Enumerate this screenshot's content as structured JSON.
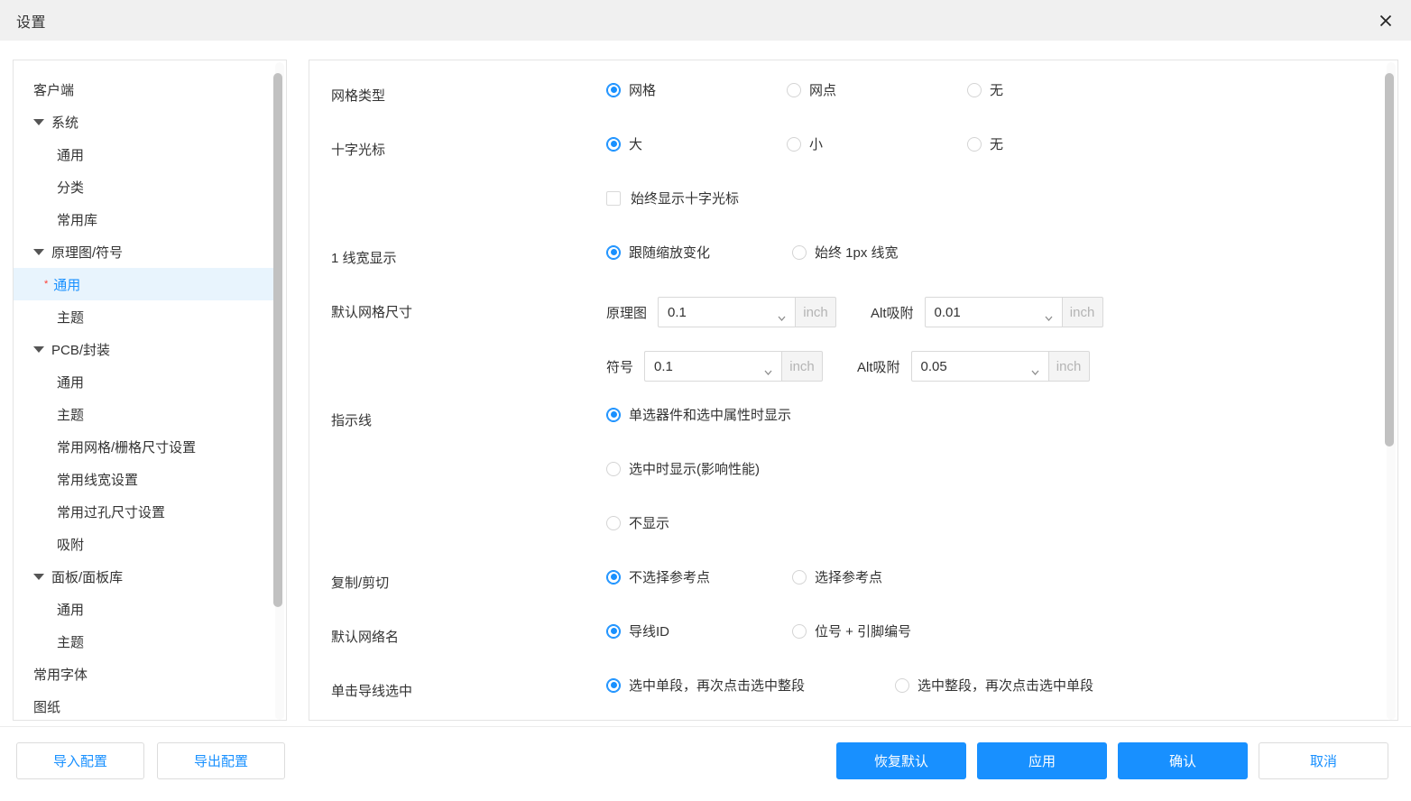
{
  "window": {
    "title": "设置",
    "close_icon": "close-icon"
  },
  "sidebar": {
    "items": [
      {
        "label": "客户端",
        "level": 0,
        "group": false,
        "selected": false,
        "required": false
      },
      {
        "label": "系统",
        "level": 0,
        "group": true,
        "selected": false,
        "required": false
      },
      {
        "label": "通用",
        "level": 1,
        "group": false,
        "selected": false,
        "required": false
      },
      {
        "label": "分类",
        "level": 1,
        "group": false,
        "selected": false,
        "required": false
      },
      {
        "label": "常用库",
        "level": 1,
        "group": false,
        "selected": false,
        "required": false
      },
      {
        "label": "原理图/符号",
        "level": 0,
        "group": true,
        "selected": false,
        "required": false
      },
      {
        "label": "通用",
        "level": 1,
        "group": false,
        "selected": true,
        "required": true
      },
      {
        "label": "主题",
        "level": 1,
        "group": false,
        "selected": false,
        "required": false
      },
      {
        "label": "PCB/封装",
        "level": 0,
        "group": true,
        "selected": false,
        "required": false
      },
      {
        "label": "通用",
        "level": 1,
        "group": false,
        "selected": false,
        "required": false
      },
      {
        "label": "主题",
        "level": 1,
        "group": false,
        "selected": false,
        "required": false
      },
      {
        "label": "常用网格/栅格尺寸设置",
        "level": 1,
        "group": false,
        "selected": false,
        "required": false
      },
      {
        "label": "常用线宽设置",
        "level": 1,
        "group": false,
        "selected": false,
        "required": false
      },
      {
        "label": "常用过孔尺寸设置",
        "level": 1,
        "group": false,
        "selected": false,
        "required": false
      },
      {
        "label": "吸附",
        "level": 1,
        "group": false,
        "selected": false,
        "required": false
      },
      {
        "label": "面板/面板库",
        "level": 0,
        "group": true,
        "selected": false,
        "required": false
      },
      {
        "label": "通用",
        "level": 1,
        "group": false,
        "selected": false,
        "required": false
      },
      {
        "label": "主题",
        "level": 1,
        "group": false,
        "selected": false,
        "required": false
      },
      {
        "label": "常用字体",
        "level": 0,
        "group": false,
        "selected": false,
        "required": false
      },
      {
        "label": "图纸",
        "level": 0,
        "group": false,
        "selected": false,
        "required": false
      }
    ]
  },
  "settings": {
    "grid_type": {
      "label": "网格类型",
      "options": [
        {
          "label": "网格",
          "selected": true
        },
        {
          "label": "网点",
          "selected": false
        },
        {
          "label": "无",
          "selected": false
        }
      ]
    },
    "crosshair": {
      "label": "十字光标",
      "options": [
        {
          "label": "大",
          "selected": true
        },
        {
          "label": "小",
          "selected": false
        },
        {
          "label": "无",
          "selected": false
        }
      ],
      "always_show": {
        "label": "始终显示十字光标",
        "checked": false
      }
    },
    "line_width_display": {
      "label": "1 线宽显示",
      "options": [
        {
          "label": "跟随缩放变化",
          "selected": true
        },
        {
          "label": "始终 1px 线宽",
          "selected": false
        }
      ]
    },
    "default_grid_size": {
      "label": "默认网格尺寸",
      "rows": [
        {
          "name_label": "原理图",
          "value": "0.1",
          "unit": "inch",
          "alt_label": "Alt吸附",
          "alt_value": "0.01",
          "alt_unit": "inch"
        },
        {
          "name_label": "符号",
          "value": "0.1",
          "unit": "inch",
          "alt_label": "Alt吸附",
          "alt_value": "0.05",
          "alt_unit": "inch"
        }
      ]
    },
    "leader_line": {
      "label": "指示线",
      "options": [
        {
          "label": "单选器件和选中属性时显示",
          "selected": true
        },
        {
          "label": "选中时显示(影响性能)",
          "selected": false
        },
        {
          "label": "不显示",
          "selected": false
        }
      ]
    },
    "copy_cut": {
      "label": "复制/剪切",
      "options": [
        {
          "label": "不选择参考点",
          "selected": true
        },
        {
          "label": "选择参考点",
          "selected": false
        }
      ]
    },
    "default_net_name": {
      "label": "默认网络名",
      "options": [
        {
          "label": "导线ID",
          "selected": true
        },
        {
          "label": "位号 + 引脚编号",
          "selected": false
        }
      ]
    },
    "click_wire_select": {
      "label": "单击导线选中",
      "options": [
        {
          "label": "选中单段，再次点击选中整段",
          "selected": true
        },
        {
          "label": "选中整段，再次点击选中单段",
          "selected": false
        }
      ]
    }
  },
  "footer": {
    "import_label": "导入配置",
    "export_label": "导出配置",
    "restore_label": "恢复默认",
    "apply_label": "应用",
    "confirm_label": "确认",
    "cancel_label": "取消"
  },
  "colors": {
    "accent": "#1890ff",
    "selected_bg": "#e8f4fd",
    "required_star": "#ff3b30",
    "titlebar_bg": "#f0f0f0"
  }
}
